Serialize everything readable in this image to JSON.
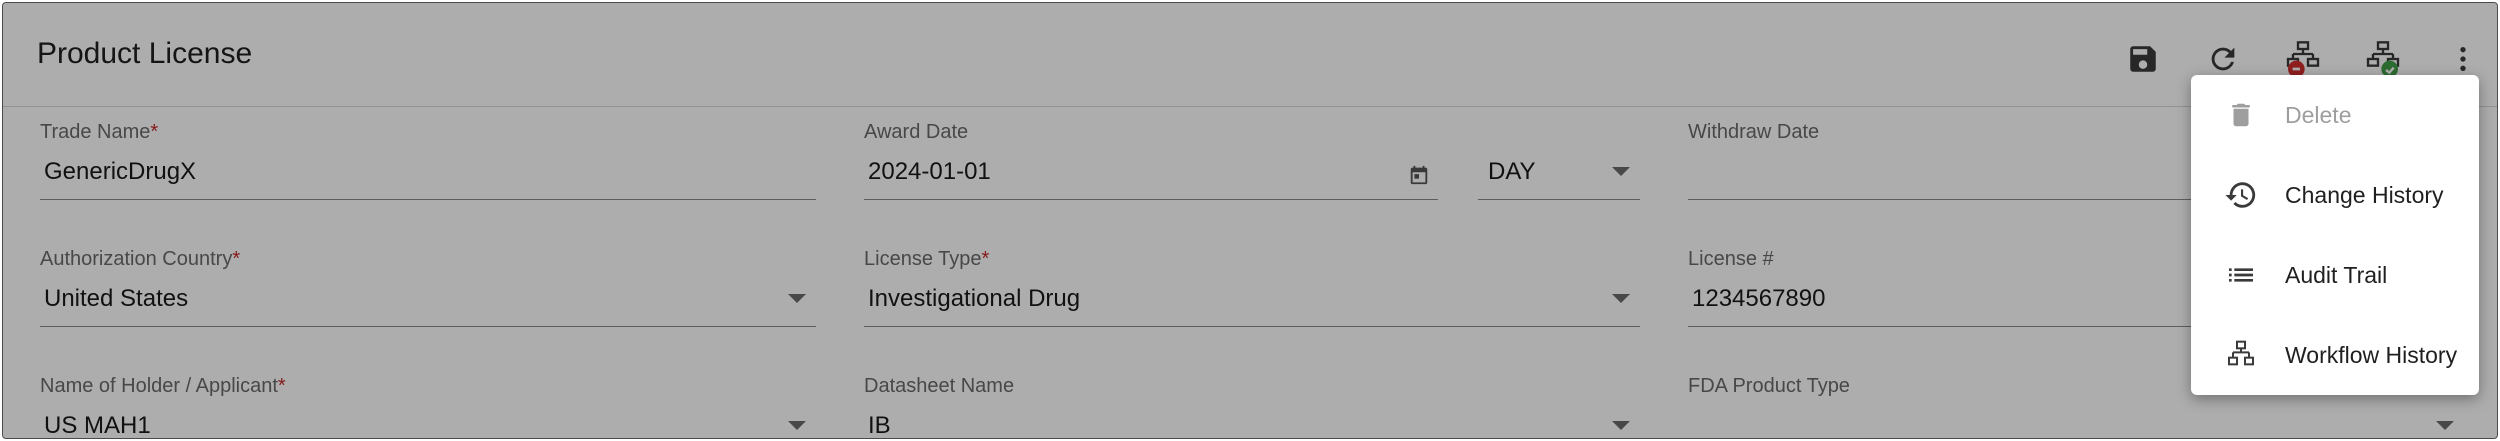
{
  "header": {
    "title": "Product License"
  },
  "fields": {
    "trade_name": {
      "label": "Trade Name",
      "required_mark": "*",
      "value": "GenericDrugX"
    },
    "award_date": {
      "label": "Award Date",
      "value": "2024-01-01",
      "unit": "DAY"
    },
    "withdraw_date": {
      "label": "Withdraw Date",
      "value": ""
    },
    "authorization_country": {
      "label": "Authorization Country",
      "required_mark": "*",
      "value": "United States"
    },
    "license_type": {
      "label": "License Type",
      "required_mark": "*",
      "value": "Investigational Drug"
    },
    "license_number": {
      "label": "License #",
      "value": "1234567890"
    },
    "holder": {
      "label": "Name of Holder / Applicant",
      "required_mark": "*",
      "value": "US MAH1"
    },
    "datasheet": {
      "label": "Datasheet Name",
      "value": "IB"
    },
    "fda_product_type": {
      "label": "FDA Product Type",
      "value": ""
    }
  },
  "menu": {
    "items": [
      {
        "label": "Delete",
        "icon": "trash-icon",
        "disabled": true
      },
      {
        "label": "Change History",
        "icon": "history-icon",
        "disabled": false
      },
      {
        "label": "Audit Trail",
        "icon": "list-icon",
        "disabled": false
      },
      {
        "label": "Workflow History",
        "icon": "workflow-icon",
        "disabled": false
      }
    ]
  },
  "colors": {
    "required": "#c62828",
    "workflow_reject": "#d32f2f",
    "workflow_approve": "#43a047",
    "overlay": "rgba(0,0,0,0.32)"
  }
}
